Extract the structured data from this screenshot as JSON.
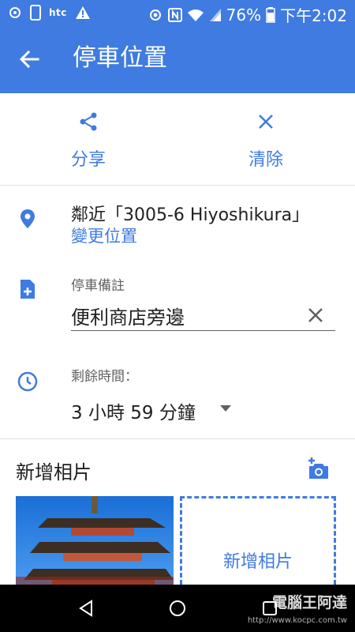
{
  "status_bar": {
    "carrier": "htc",
    "battery": "76%",
    "time": "下午2:02"
  },
  "app_bar": {
    "title": "停車位置"
  },
  "actions": {
    "share_label": "分享",
    "clear_label": "清除"
  },
  "location": {
    "text": "鄰近「3005-6 Hiyoshikura」",
    "change_label": "變更位置"
  },
  "note": {
    "label": "停車備註",
    "value": "便利商店旁邊"
  },
  "time_remaining": {
    "label": "剩餘時間：",
    "value": "3 小時 59 分鐘"
  },
  "photos": {
    "heading": "新增相片",
    "add_tile_label": "新增相片"
  },
  "watermark": {
    "text": "電腦王阿達",
    "url": "http://www.kocpc.com.tw"
  },
  "colors": {
    "accent": "#3f7be0"
  }
}
